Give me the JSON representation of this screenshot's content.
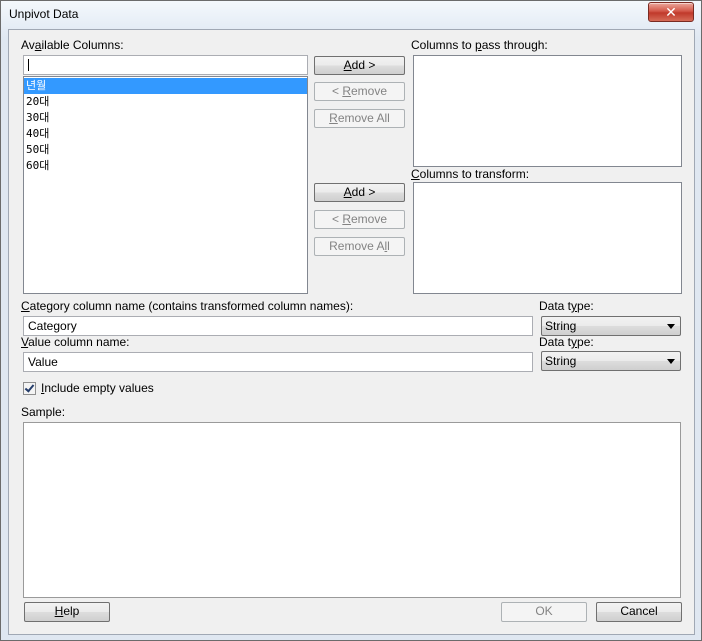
{
  "window": {
    "title": "Unpivot Data",
    "close_glyph": "✕"
  },
  "available_columns": {
    "label_pre": "Av",
    "label_accel": "a",
    "label_post": "ilable Columns:",
    "filter_value": "",
    "items": [
      {
        "label": "년월",
        "selected": true
      },
      {
        "label": "20대",
        "selected": false
      },
      {
        "label": "30대",
        "selected": false
      },
      {
        "label": "40대",
        "selected": false
      },
      {
        "label": "50대",
        "selected": false
      },
      {
        "label": "60대",
        "selected": false
      }
    ]
  },
  "pass_through": {
    "label_pre": "Columns to ",
    "label_accel": "p",
    "label_post": "ass through:",
    "add_accel": "A",
    "add_rest": "dd >",
    "remove_pre": "< ",
    "remove_accel": "R",
    "remove_rest": "emove",
    "remove_all_accel": "R",
    "remove_all_rest": "emove All"
  },
  "transform": {
    "label_pre": "",
    "label_accel": "C",
    "label_post": "olumns to transform:",
    "add_accel": "A",
    "add_rest": "dd >",
    "remove_pre": "< ",
    "remove_accel": "R",
    "remove_rest": "emove",
    "remove_all_pre": "Remove A",
    "remove_all_accel": "l",
    "remove_all_rest": "l"
  },
  "category": {
    "label_accel": "C",
    "label_post": "ategory column name (contains transformed column names):",
    "value": "Category",
    "type_label_pre": "Data t",
    "type_label_accel": "y",
    "type_label_post": "pe:",
    "type_value": "String"
  },
  "value_column": {
    "label_accel": "V",
    "label_post": "alue column name:",
    "value": "Value",
    "type_label_pre": "Data t",
    "type_label_accel": "y",
    "type_label_post": "pe:",
    "type_value": "String"
  },
  "include_empty": {
    "checked": true,
    "label_accel": "I",
    "label_post": "nclude empty values"
  },
  "sample": {
    "label": "Sample:"
  },
  "footer": {
    "help_accel": "H",
    "help_rest": "elp",
    "ok_label": "OK",
    "cancel_label": "Cancel"
  }
}
